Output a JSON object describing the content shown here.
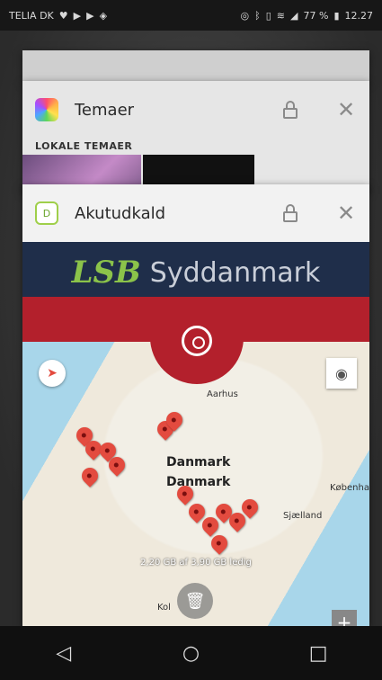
{
  "status_bar": {
    "carrier": "TELIA DK",
    "left_icons": [
      "heart-icon",
      "play-icon",
      "play-icon",
      "shield-icon"
    ],
    "right_icons": [
      "location-icon",
      "bluetooth-icon",
      "vibrate-icon",
      "wifi-icon",
      "signal-icon"
    ],
    "battery": "77 %",
    "time": "12.27"
  },
  "recent_apps": [
    {
      "title": "Temaer",
      "icon": "temaer-app-icon",
      "section_label": "LOKALE TEMAER"
    },
    {
      "title": "Akutudkald",
      "icon": "akutudkald-app-icon",
      "banner": {
        "logo_text": "LSB",
        "region_text": "Syddanmark"
      },
      "map": {
        "labels": [
          "Aarhus",
          "Danmark",
          "Danmark",
          "København",
          "Sjælland",
          "Kol"
        ]
      }
    }
  ],
  "memory_info": "2,20 GB af 3,90 GB ledig",
  "nav_bar": [
    "back-button",
    "home-button",
    "recents-button"
  ],
  "colors": {
    "brand_red": "#b3202c",
    "banner_navy": "#1f2e4a",
    "pin_red": "#e34b3f"
  }
}
